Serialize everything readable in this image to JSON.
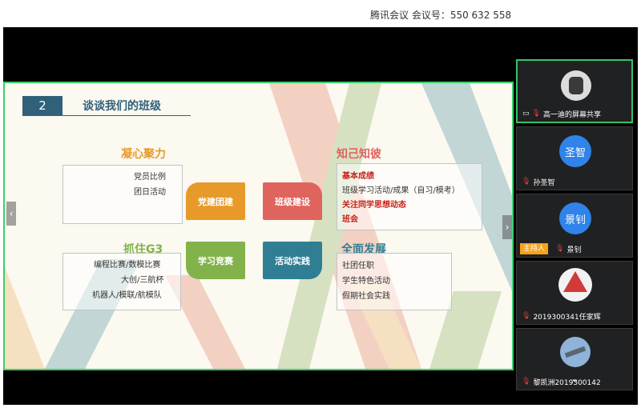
{
  "header": {
    "title": "腾讯会议  会议号：550 632 558"
  },
  "slide": {
    "section_number": "2",
    "section_title": "谈谈我们的班级",
    "left_top": {
      "title": "凝心聚力",
      "lines": [
        "党员比例",
        "团日活动"
      ]
    },
    "right_top": {
      "title": "知己知彼",
      "lines": [
        "基本成绩",
        "班级学习活动/成果（自习/模考）",
        "关注同学思想动态",
        "班会"
      ]
    },
    "left_bottom": {
      "title": "抓住G3",
      "lines": [
        "编程比赛/数模比赛",
        "大创/三航杯",
        "机器人/模联/航模队"
      ]
    },
    "right_bottom": {
      "title": "全面发展",
      "lines": [
        "社团任职",
        "学生特色活动",
        "假期社会实践"
      ]
    },
    "tiles": [
      "党建团建",
      "班级建设",
      "学习竞赛",
      "活动实践"
    ],
    "colors": {
      "orange": "#e79a29",
      "red": "#e0645e",
      "green": "#82b24a",
      "teal": "#2f7e94"
    }
  },
  "participants": [
    {
      "name": "高一迪的屏幕共享",
      "icon": "screen-share-icon",
      "avatar": ""
    },
    {
      "name": "孙圣智",
      "avatar": "圣智"
    },
    {
      "name": "景钊",
      "avatar": "景钊",
      "badge": "主持人"
    },
    {
      "name": "2019300341任家辉",
      "avatar": ""
    },
    {
      "name": "黎凯洲2019300142",
      "avatar": ""
    }
  ]
}
